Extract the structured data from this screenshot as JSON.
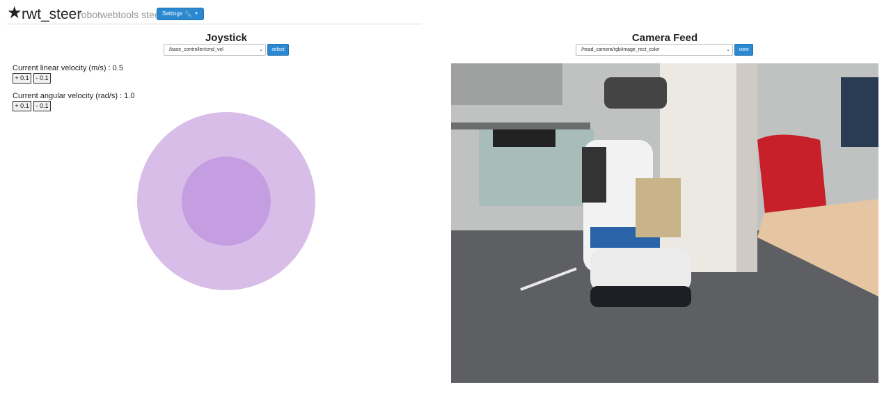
{
  "header": {
    "star_icon": "star-icon",
    "title": "rwt_steer",
    "subtitle": "robotwebtools steer",
    "settings_label": "Settings"
  },
  "joystick": {
    "title": "Joystick",
    "topic": "/base_controller/cmd_vel",
    "select_label": "select",
    "linear_label": "Current linear velocity (m/s) : 0.5",
    "angular_label": "Current angular velocity (rad/s) : 1.0",
    "plus_label": "+ 0.1",
    "minus_label": "- 0.1",
    "colors": {
      "outer": "#d8bde9",
      "inner": "#c49ee0"
    }
  },
  "camera": {
    "title": "Camera Feed",
    "topic": "/head_camera/rgb/image_rect_color",
    "view_label": "view"
  }
}
